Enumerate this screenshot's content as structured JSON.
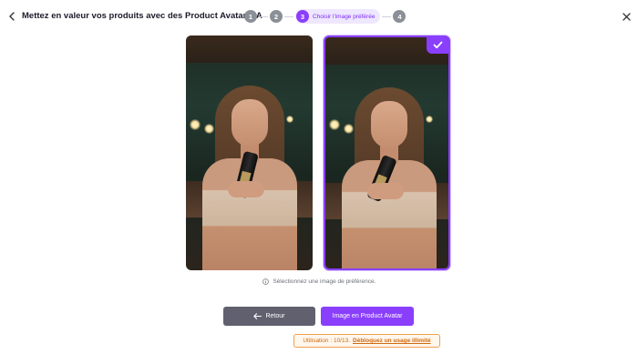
{
  "header": {
    "title": "Mettez en valeur vos produits avec des Product Avatars IA",
    "back_icon": "chevron-left-icon",
    "close_icon": "close-icon"
  },
  "stepper": {
    "steps": [
      {
        "number": "1"
      },
      {
        "number": "2"
      },
      {
        "number": "3",
        "label": "Choisir l'image préférée",
        "active": true
      },
      {
        "number": "4"
      }
    ]
  },
  "gallery": {
    "selected_index": 1,
    "images": [
      {
        "icon": "portrait-photo-icon"
      },
      {
        "icon": "portrait-photo-icon",
        "selected": true
      }
    ]
  },
  "hint": {
    "icon": "info-icon",
    "text": "Sélectionnez une image de préférence."
  },
  "actions": {
    "back_label": "Retour",
    "back_icon": "arrow-left-icon",
    "primary_label": "Image en Product Avatar"
  },
  "usage": {
    "text": "Utilisation : 10/13.",
    "link": "Débloquez un usage illimité"
  },
  "colors": {
    "accent": "#8a3ffc",
    "secondary_button": "#60606f",
    "usage_border": "#f0a050",
    "usage_text": "#d06a10"
  }
}
